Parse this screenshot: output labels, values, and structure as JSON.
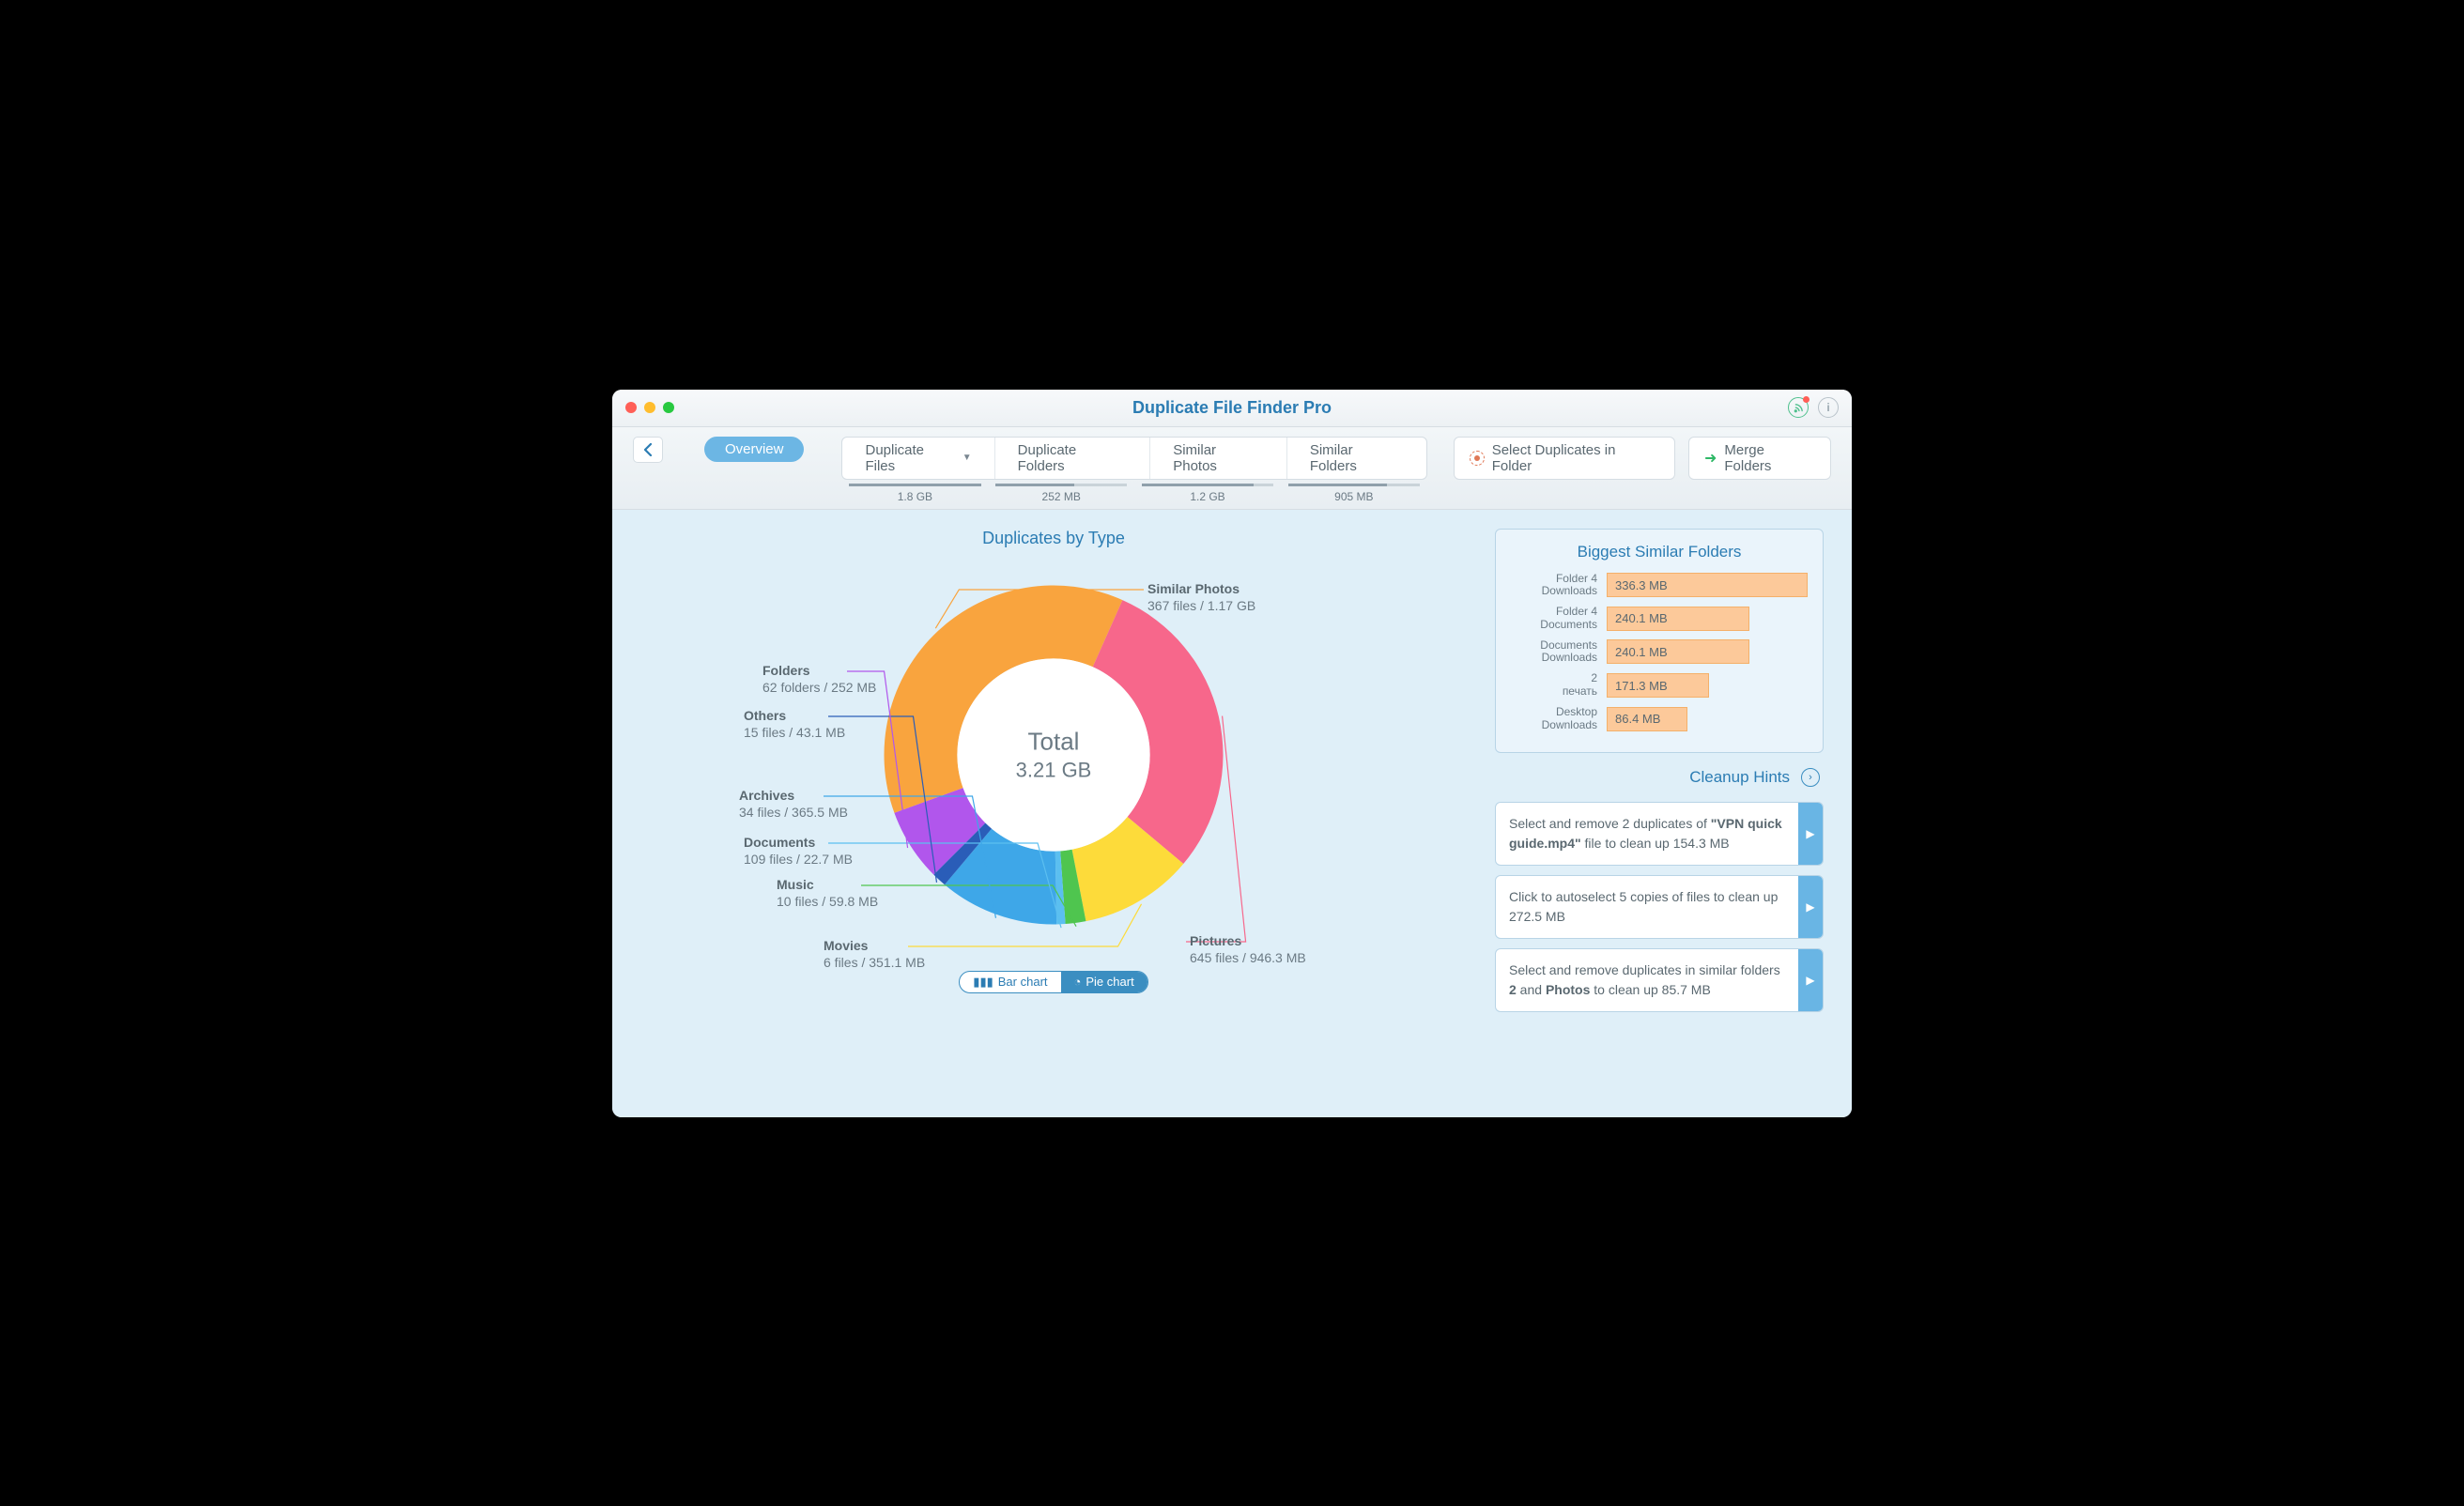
{
  "title": "Duplicate File Finder Pro",
  "toolbar": {
    "overview": "Overview",
    "tabs": [
      {
        "label": "Duplicate Files",
        "size": "1.8 GB",
        "dropdown": true,
        "fill": 100
      },
      {
        "label": "Duplicate Folders",
        "size": "252 MB",
        "dropdown": false,
        "fill": 60
      },
      {
        "label": "Similar Photos",
        "size": "1.2 GB",
        "dropdown": false,
        "fill": 85
      },
      {
        "label": "Similar Folders",
        "size": "905 MB",
        "dropdown": false,
        "fill": 75
      }
    ],
    "select_label": "Select Duplicates in Folder",
    "merge_label": "Merge Folders"
  },
  "chart": {
    "title": "Duplicates by Type",
    "center_label": "Total",
    "center_value": "3.21 GB",
    "switch_bar": "Bar chart",
    "switch_pie": "Pie chart"
  },
  "chart_data": {
    "type": "pie",
    "title": "Duplicates by Type",
    "total_label": "Total",
    "total_value_gb": 3.21,
    "series": [
      {
        "name": "Similar Photos",
        "files": 367,
        "size_mb": 1198,
        "display": "367 files / 1.17 GB",
        "color": "#f9a43e",
        "angle": 134
      },
      {
        "name": "Pictures",
        "files": 645,
        "size_mb": 946.3,
        "display": "645 files / 946.3 MB",
        "color": "#f7678b",
        "angle": 106
      },
      {
        "name": "Movies",
        "files": 6,
        "size_mb": 351.1,
        "display": "6 files / 351.1 MB",
        "color": "#fddb3a",
        "angle": 39
      },
      {
        "name": "Music",
        "files": 10,
        "size_mb": 59.8,
        "display": "10 files / 59.8 MB",
        "color": "#4fc54f",
        "angle": 7
      },
      {
        "name": "Documents",
        "files": 109,
        "size_mb": 22.7,
        "display": "109 files / 22.7 MB",
        "color": "#5bbff0",
        "angle": 3
      },
      {
        "name": "Archives",
        "files": 34,
        "size_mb": 365.5,
        "display": "34 files / 365.5 MB",
        "color": "#3ea7e8",
        "angle": 41
      },
      {
        "name": "Others",
        "files": 15,
        "size_mb": 43.1,
        "display": "15 files / 43.1 MB",
        "color": "#2a5db8",
        "angle": 5
      },
      {
        "name": "Folders",
        "files": 62,
        "size_mb": 252,
        "display": "62 folders / 252 MB",
        "color": "#b156ec",
        "angle": 25
      }
    ]
  },
  "biggest": {
    "title": "Biggest Similar Folders",
    "rows": [
      {
        "line1": "Folder 4",
        "line2": "Downloads",
        "size": "336.3 MB",
        "pct": 100
      },
      {
        "line1": "Folder 4",
        "line2": "Documents",
        "size": "240.1 MB",
        "pct": 71
      },
      {
        "line1": "Documents",
        "line2": "Downloads",
        "size": "240.1 MB",
        "pct": 71
      },
      {
        "line1": "2",
        "line2": "печать",
        "size": "171.3 MB",
        "pct": 51
      },
      {
        "line1": "Desktop",
        "line2": "Downloads",
        "size": "86.4 MB",
        "pct": 40
      }
    ]
  },
  "hints": {
    "title": "Cleanup Hints",
    "items": [
      {
        "pre": "Select and remove 2 duplicates of ",
        "b1": "\"VPN quick guide.mp4\"",
        "mid": " file to clean up 154.3 MB",
        "b2": "",
        "post": ""
      },
      {
        "pre": "Click to autoselect 5 copies of files to clean up 272.5 MB",
        "b1": "",
        "mid": "",
        "b2": "",
        "post": ""
      },
      {
        "pre": "Select and remove duplicates in similar folders ",
        "b1": "2",
        "mid": " and ",
        "b2": "Photos",
        "post": " to clean up 85.7 MB"
      }
    ]
  }
}
